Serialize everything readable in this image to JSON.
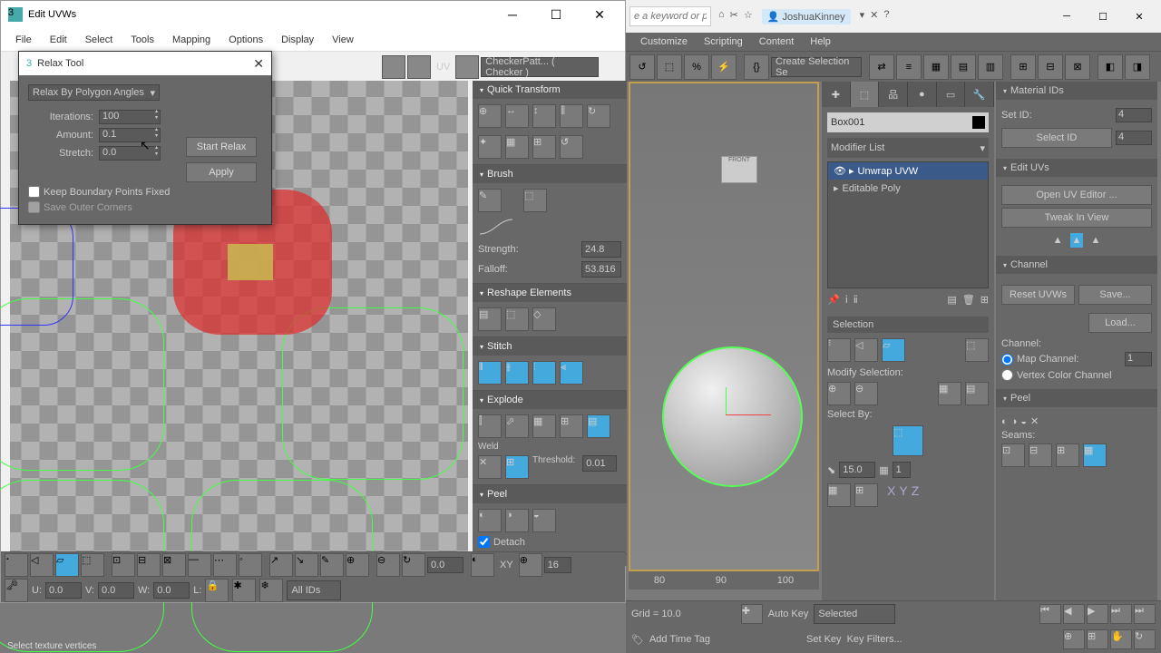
{
  "app": {
    "search_placeholder": "e a keyword or phrase",
    "user": "JoshuaKinney",
    "menu": [
      "Customize",
      "Scripting",
      "Content",
      "Help"
    ],
    "selection_set": "Create Selection Se"
  },
  "uvw": {
    "title": "Edit UVWs",
    "menu": [
      "File",
      "Edit",
      "Select",
      "Tools",
      "Mapping",
      "Options",
      "Display",
      "View"
    ],
    "uv_label": "UV",
    "texture_dropdown": "CheckerPatt... ( Checker )",
    "panels": {
      "quick_transform": "Quick Transform",
      "brush": "Brush",
      "brush_strength_label": "Strength:",
      "brush_strength": "24.8",
      "brush_falloff_label": "Falloff:",
      "brush_falloff": "53.816",
      "reshape": "Reshape Elements",
      "stitch": "Stitch",
      "explode": "Explode",
      "weld_label": "Weld",
      "threshold_label": "Threshold:",
      "threshold": "0.01",
      "peel": "Peel",
      "detach_label": "Detach"
    },
    "bottom": {
      "u_label": "U:",
      "u_val": "0.0",
      "v_label": "V:",
      "v_val": "0.0",
      "w_label": "W:",
      "w_val": "0.0",
      "l_label": "L:",
      "all_ids": "All IDs",
      "xy_label": "XY",
      "step": "16",
      "rot": "0.0"
    }
  },
  "relax": {
    "title": "Relax Tool",
    "method": "Relax By Polygon Angles",
    "iterations_label": "Iterations:",
    "iterations": "100",
    "amount_label": "Amount:",
    "amount": "0.1",
    "stretch_label": "Stretch:",
    "stretch": "0.0",
    "keep_boundary": "Keep Boundary Points Fixed",
    "save_outer": "Save Outer Corners",
    "start_btn": "Start Relax",
    "apply_btn": "Apply"
  },
  "cmd": {
    "object_name": "Box001",
    "modifier_list": "Modifier List",
    "stack": [
      "Unwrap UVW",
      "Editable Poly"
    ],
    "selection_header": "Selection",
    "modify_selection": "Modify Selection:",
    "select_by": "Select By:",
    "angle": "15.0",
    "count": "1",
    "axes": [
      "X",
      "Y",
      "Z"
    ]
  },
  "right": {
    "material_ids": "Material IDs",
    "set_id_label": "Set ID:",
    "set_id": "4",
    "select_id_label": "Select ID",
    "select_id": "4",
    "edit_uvs": "Edit UVs",
    "open_editor": "Open UV Editor ...",
    "tweak": "Tweak In View",
    "channel": "Channel",
    "reset": "Reset UVWs",
    "save": "Save...",
    "load": "Load...",
    "channel_label": "Channel:",
    "map_channel": "Map Channel:",
    "map_val": "1",
    "vertex_color": "Vertex Color Channel",
    "peel": "Peel",
    "seams": "Seams:"
  },
  "status": {
    "grid": "Grid = 10.0",
    "add_time": "Add Time Tag",
    "auto_key": "Auto Key",
    "selected": "Selected",
    "set_key": "Set Key",
    "key_filters": "Key Filters...",
    "hint": "Select texture vertices",
    "ruler": [
      "80",
      "90",
      "100"
    ]
  }
}
